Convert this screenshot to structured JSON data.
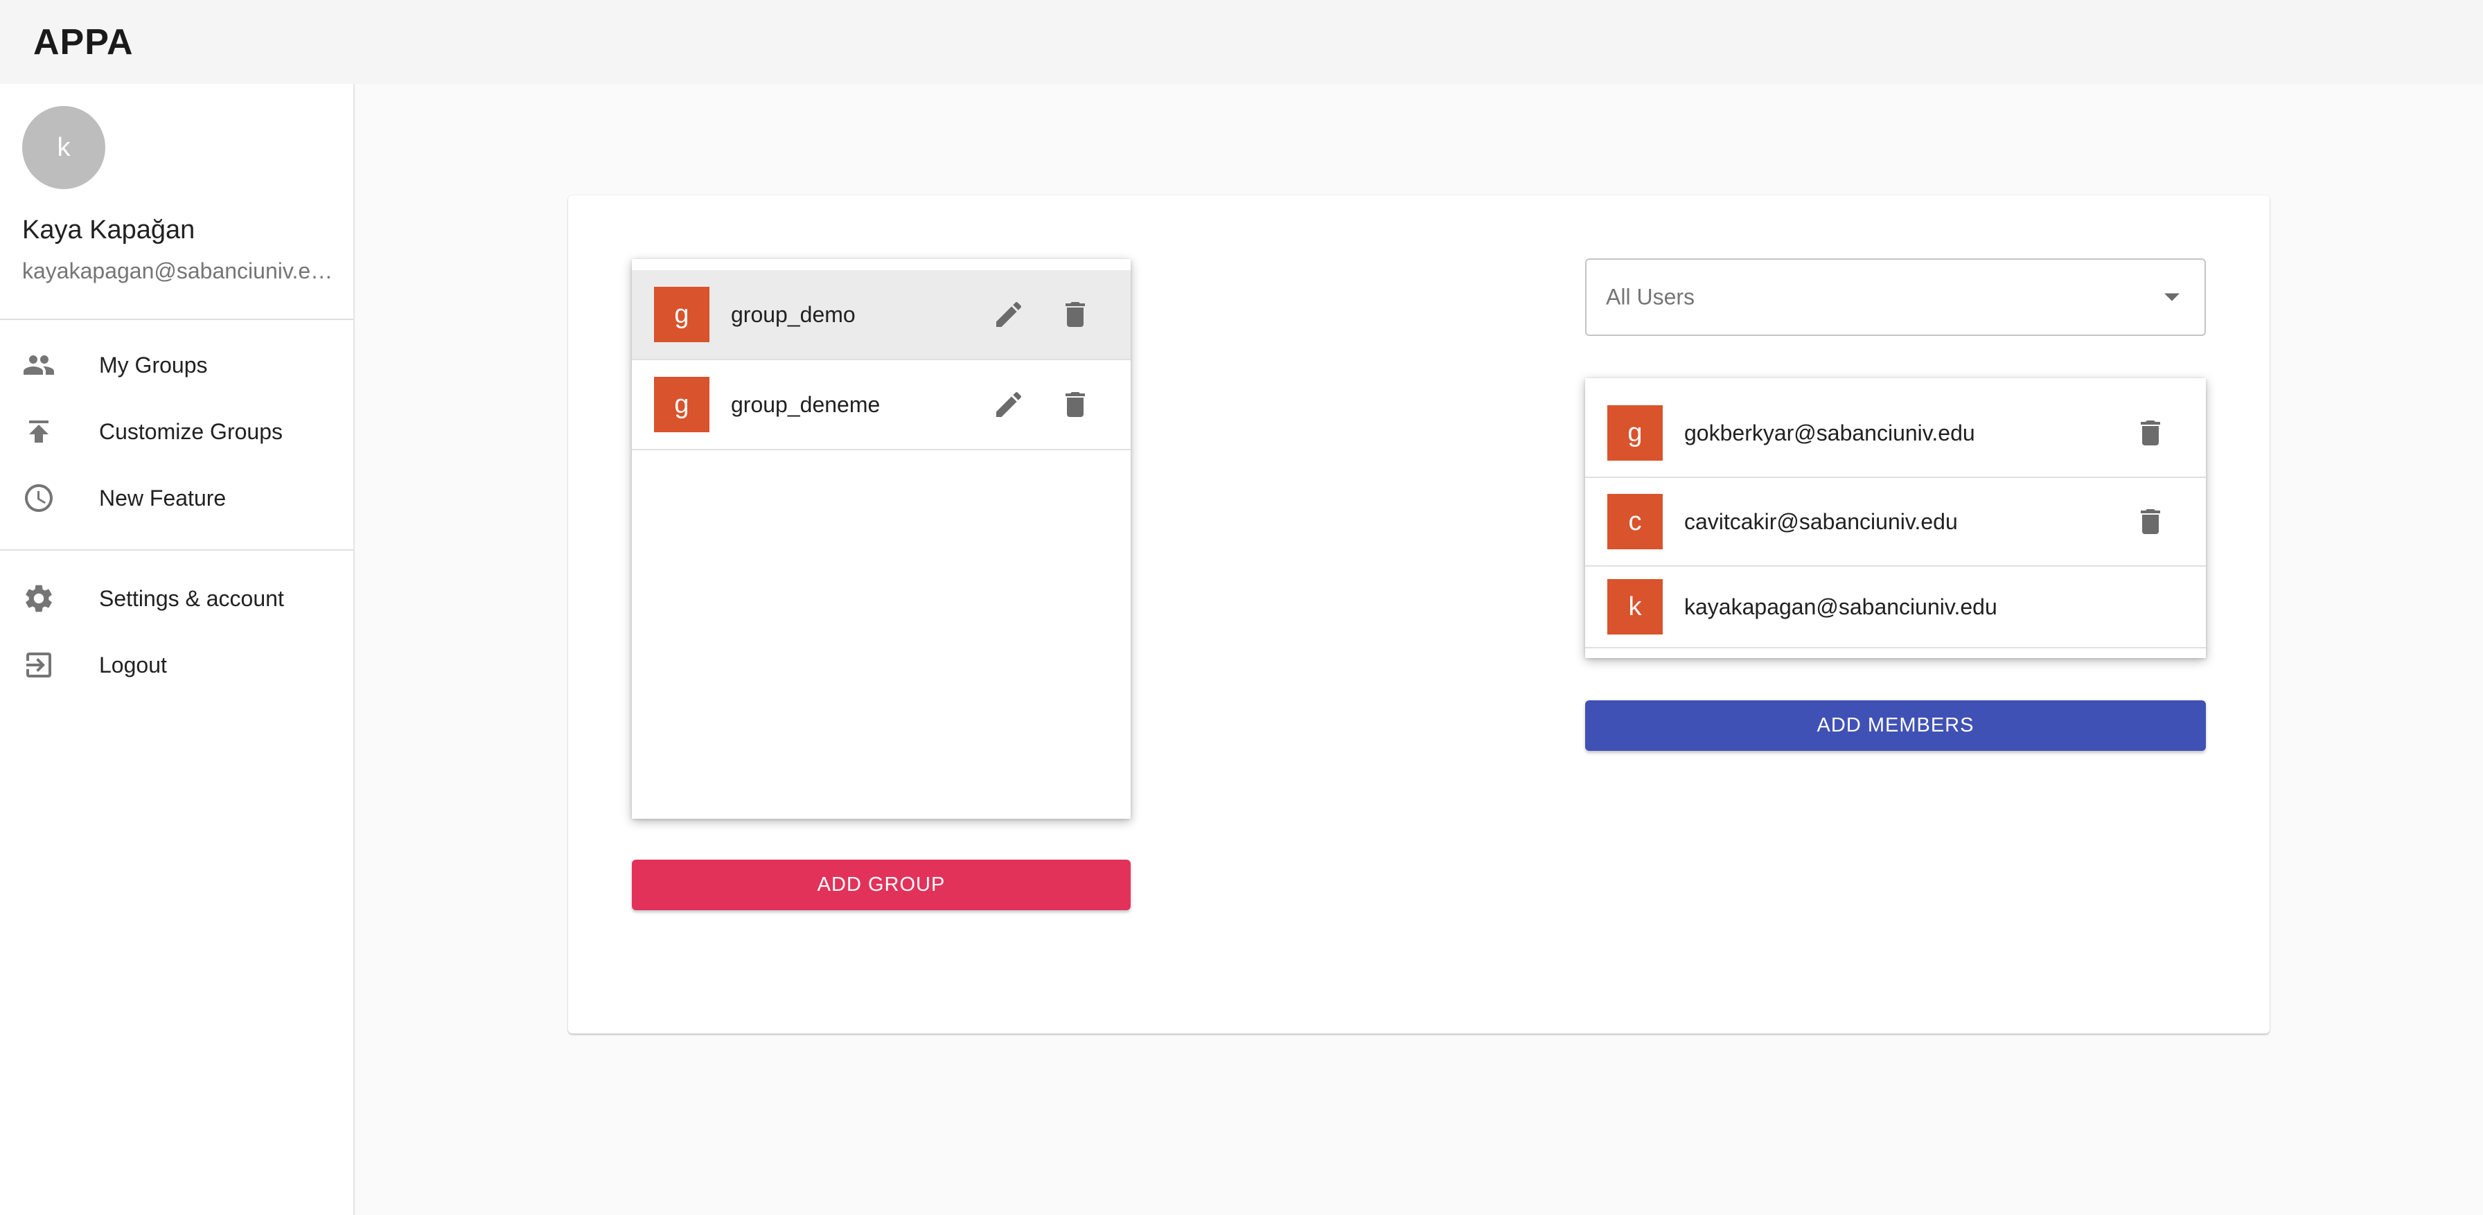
{
  "app": {
    "title": "APPA"
  },
  "user": {
    "avatar_letter": "k",
    "name": "Kaya Kapağan",
    "email": "kayakapagan@sabanciuniv.edu"
  },
  "nav": {
    "primary": [
      {
        "label": "My Groups",
        "icon": "people-icon"
      },
      {
        "label": "Customize Groups",
        "icon": "publish-icon"
      },
      {
        "label": "New Feature",
        "icon": "clock-icon"
      }
    ],
    "secondary": [
      {
        "label": "Settings & account",
        "icon": "gear-icon"
      },
      {
        "label": "Logout",
        "icon": "logout-icon"
      }
    ]
  },
  "groups": {
    "items": [
      {
        "letter": "g",
        "name": "group_demo",
        "selected": true
      },
      {
        "letter": "g",
        "name": "group_deneme",
        "selected": false
      }
    ],
    "add_label": "ADD GROUP"
  },
  "members": {
    "filter_label": "All Users",
    "items": [
      {
        "letter": "g",
        "email": "gokberkyar@sabanciuniv.edu",
        "deletable": true
      },
      {
        "letter": "c",
        "email": "cavitcakir@sabanciuniv.edu",
        "deletable": true
      },
      {
        "letter": "k",
        "email": "kayakapagan@sabanciuniv.edu",
        "deletable": false
      }
    ],
    "add_label": "ADD MEMBERS"
  },
  "colors": {
    "avatar_orange": "#d9532c",
    "add_group_pink": "#e2325a",
    "add_members_indigo": "#4051b5",
    "icon_grey": "#6b6b6b"
  }
}
